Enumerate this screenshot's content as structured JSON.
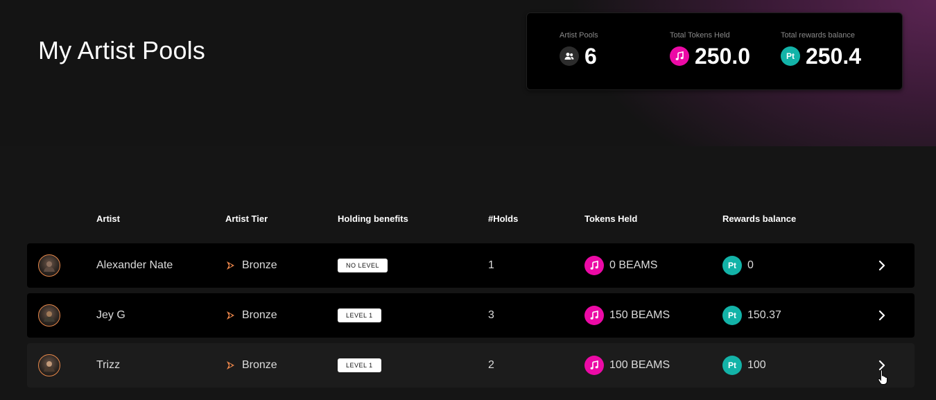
{
  "page": {
    "title": "My Artist Pools"
  },
  "stats": [
    {
      "label": "Artist Pools",
      "value": "6",
      "icon": "users-icon"
    },
    {
      "label": "Total Tokens Held",
      "value": "250.0",
      "icon": "music-note-icon"
    },
    {
      "label": "Total rewards balance",
      "value": "250.4",
      "icon": "pt-token-icon",
      "icon_text": "Pt"
    }
  ],
  "table": {
    "headers": {
      "artist": "Artist",
      "tier": "Artist Tier",
      "benefits": "Holding benefits",
      "holds": "#Holds",
      "tokens": "Tokens Held",
      "rewards": "Rewards balance"
    },
    "rows": [
      {
        "artist": "Alexander Nate",
        "tier": "Bronze",
        "benefit": "NO LEVEL",
        "holds": "1",
        "tokens": "0 BEAMS",
        "rewards": "0"
      },
      {
        "artist": "Jey G",
        "tier": "Bronze",
        "benefit": "LEVEL 1",
        "holds": "3",
        "tokens": "150 BEAMS",
        "rewards": "150.37"
      },
      {
        "artist": "Trizz",
        "tier": "Bronze",
        "benefit": "LEVEL 1",
        "holds": "2",
        "tokens": "100 BEAMS",
        "rewards": "100"
      }
    ]
  },
  "colors": {
    "music_token": "#ec0aa6",
    "pt_token": "#13b3a8",
    "tier_bronze": "#e8844a",
    "avatar_ring": "#e8884a"
  }
}
